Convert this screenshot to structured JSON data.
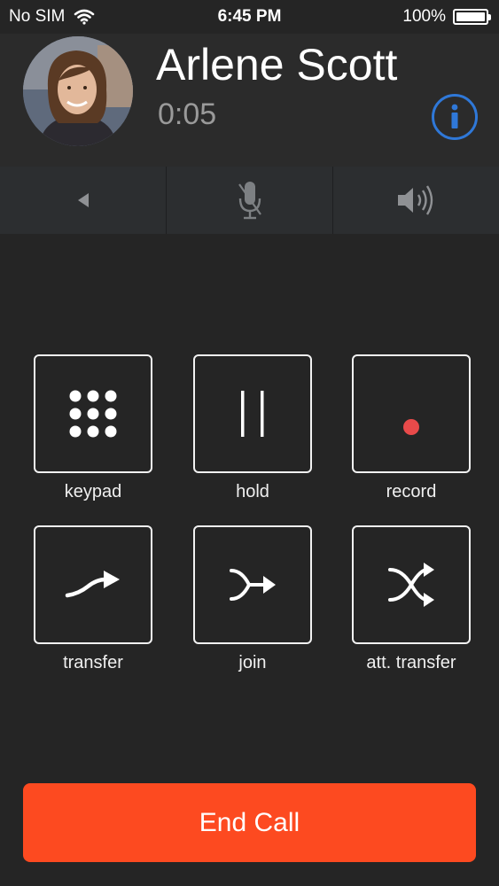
{
  "status_bar": {
    "carrier": "No SIM",
    "time": "6:45 PM",
    "battery_percent": "100%",
    "battery_level": 1.0
  },
  "call": {
    "caller_name": "Arlene Scott",
    "duration": "0:05"
  },
  "audio_controls": {
    "items": [
      {
        "icon": "back-arrow-icon"
      },
      {
        "icon": "microphone-muted-icon"
      },
      {
        "icon": "speaker-icon"
      }
    ]
  },
  "actions": {
    "keypad": "keypad",
    "hold": "hold",
    "record": "record",
    "transfer": "transfer",
    "join": "join",
    "att_transfer": "att. transfer"
  },
  "end_call": {
    "label": "End Call"
  },
  "colors": {
    "background": "#252525",
    "header": "#2b2b2b",
    "info_blue": "#2f78d8",
    "record_red": "#e84a4a",
    "end_call": "#fd4a20"
  }
}
